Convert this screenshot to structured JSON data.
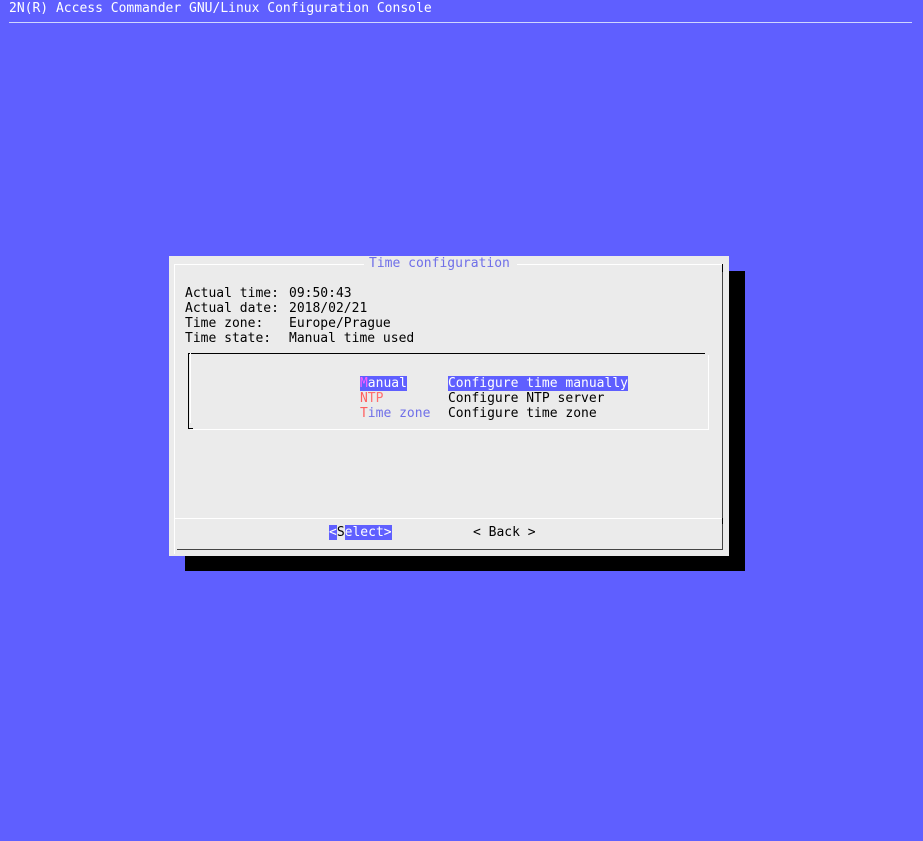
{
  "backtitle": "2N(R) Access Commander GNU/Linux Configuration Console",
  "dialog": {
    "title": "Time configuration",
    "info": [
      {
        "label": "Actual time:",
        "value": "09:50:43"
      },
      {
        "label": "Actual date:",
        "value": "2018/02/21"
      },
      {
        "label": "Time zone:",
        "value": "Europe/Prague"
      },
      {
        "label": "Time state:",
        "value": "Manual time used"
      }
    ],
    "menu": [
      {
        "hotkey": "M",
        "rest": "anual",
        "description": "Configure time manually",
        "selected": true
      },
      {
        "hotkey": "N",
        "rest": "TP",
        "description": "Configure NTP server",
        "selected": false
      },
      {
        "hotkey": "T",
        "rest": "ime zone",
        "description": "Configure time zone",
        "selected": false
      }
    ],
    "buttons": {
      "select": {
        "left": "<",
        "cursor": "S",
        "rest": "elect>"
      },
      "back": "< Back >"
    }
  },
  "colors": {
    "background": "#5f5fff",
    "dialog": "#ebebeb",
    "highlight": "#5f5fff",
    "hotkey": "#ff5f5f",
    "title": "#6f6fe8"
  }
}
